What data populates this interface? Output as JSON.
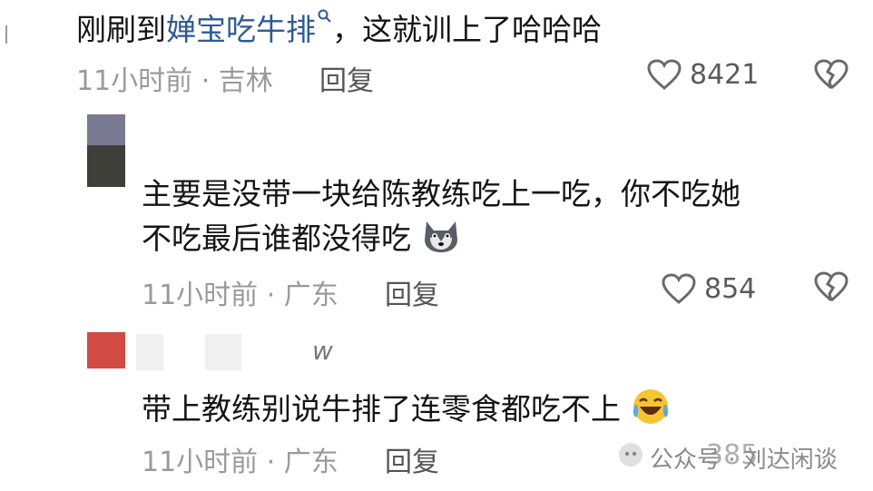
{
  "comments": [
    {
      "text_plain_before": "刚刷到",
      "text_link": "婵宝吃牛排",
      "text_plain_after": "，这就训上了哈哈哈",
      "time": "11小时前",
      "location": "吉林",
      "reply_label": "回复",
      "likes": "8421"
    },
    {
      "line1": "主要是没带一块给陈教练吃上一吃，你不吃她",
      "line2": "不吃最后谁都没得吃",
      "emoji": "wolf-emoji",
      "time": "11小时前",
      "location": "广东",
      "reply_label": "回复",
      "likes": "854"
    },
    {
      "name_fragment": "w",
      "text": "带上教练别说牛排了连零食都吃不上",
      "emoji": "laughing-crying-emoji",
      "time": "11小时前",
      "location": "广东",
      "reply_label": "回复",
      "likes": "385"
    }
  ],
  "watermark": {
    "text": "公众号 · 刘达闲谈",
    "icon": "wechat-official-account-icon"
  },
  "colors": {
    "link": "#2f5b93",
    "meta": "#9a9a9a",
    "avatar2_top": "#7b7a93",
    "avatar2_bottom": "#3f3f3a",
    "avatar3": "#d24a44"
  }
}
